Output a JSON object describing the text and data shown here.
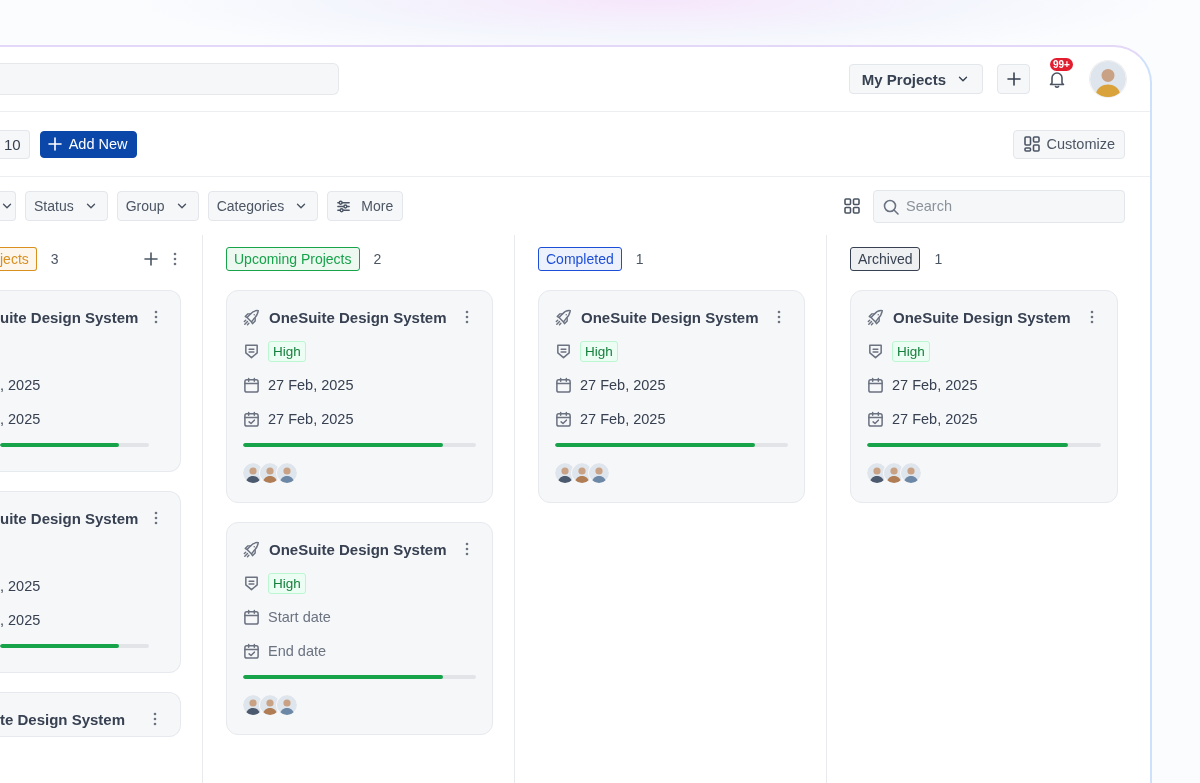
{
  "header": {
    "workspace": "My Projects",
    "notification_badge": "99+"
  },
  "toolbar": {
    "pager": "10",
    "add_button": "Add New",
    "customize_button": "Customize"
  },
  "filters": [
    {
      "kind": "cut"
    },
    {
      "kind": "dropdown",
      "label": "Status"
    },
    {
      "kind": "dropdown",
      "label": "Group"
    },
    {
      "kind": "dropdown",
      "label": "Categories"
    },
    {
      "kind": "menu",
      "label": "More"
    }
  ],
  "search": {
    "placeholder": "Search"
  },
  "columns": [
    {
      "title": "jects",
      "count": "3",
      "color": "#d9901f",
      "cut": true,
      "actions": [
        {
          "kind": "add"
        },
        {
          "kind": "more"
        }
      ],
      "cards": [
        {
          "title": "uite Design System",
          "start": {
            "text": ", 2025",
            "empty": false
          },
          "end": {
            "text": ", 2025",
            "empty": false
          },
          "level": 0.8
        },
        {
          "title": "uite Design System",
          "start": {
            "text": ", 2025",
            "empty": false
          },
          "end": {
            "text": ", 2025",
            "empty": false
          },
          "level": 0.8
        },
        {
          "title": "te Design System"
        }
      ]
    },
    {
      "title": "Upcoming Projects",
      "count": "2",
      "color": "#16a34a",
      "cut": false,
      "cards": [
        {
          "title": "OneSuite Design System",
          "priority": "High",
          "start": {
            "text": "27 Feb, 2025",
            "empty": false
          },
          "end": {
            "text": "27 Feb, 2025",
            "empty": false
          },
          "level": 0.86,
          "avatars": [
            {
              "color": "#4b5a6e"
            },
            {
              "color": "#b07d55"
            },
            {
              "color": "#6d88a6"
            }
          ]
        },
        {
          "title": "OneSuite Design System",
          "priority": "High",
          "start": {
            "text": "Start date",
            "empty": true
          },
          "end": {
            "text": "End date",
            "empty": true
          },
          "level": 0.86,
          "avatars": [
            {
              "color": "#4b5a6e"
            },
            {
              "color": "#b07d55"
            },
            {
              "color": "#6d88a6"
            }
          ]
        }
      ]
    },
    {
      "title": "Completed",
      "count": "1",
      "color": "#1d4ed8",
      "cut": false,
      "cards": [
        {
          "title": "OneSuite Design System",
          "priority": "High",
          "start": {
            "text": "27 Feb, 2025",
            "empty": false
          },
          "end": {
            "text": "27 Feb, 2025",
            "empty": false
          },
          "level": 0.86,
          "avatars": [
            {
              "color": "#4b5a6e"
            },
            {
              "color": "#b07d55"
            },
            {
              "color": "#6d88a6"
            }
          ]
        }
      ]
    },
    {
      "title": "Archived",
      "count": "1",
      "color": "#374151",
      "cut": false,
      "cards": [
        {
          "title": "OneSuite Design System",
          "priority": "High",
          "start": {
            "text": "27 Feb, 2025",
            "empty": false
          },
          "end": {
            "text": "27 Feb, 2025",
            "empty": false
          },
          "level": 0.86,
          "avatars": [
            {
              "color": "#4b5a6e"
            },
            {
              "color": "#b07d55"
            },
            {
              "color": "#6d88a6"
            }
          ]
        }
      ]
    }
  ]
}
